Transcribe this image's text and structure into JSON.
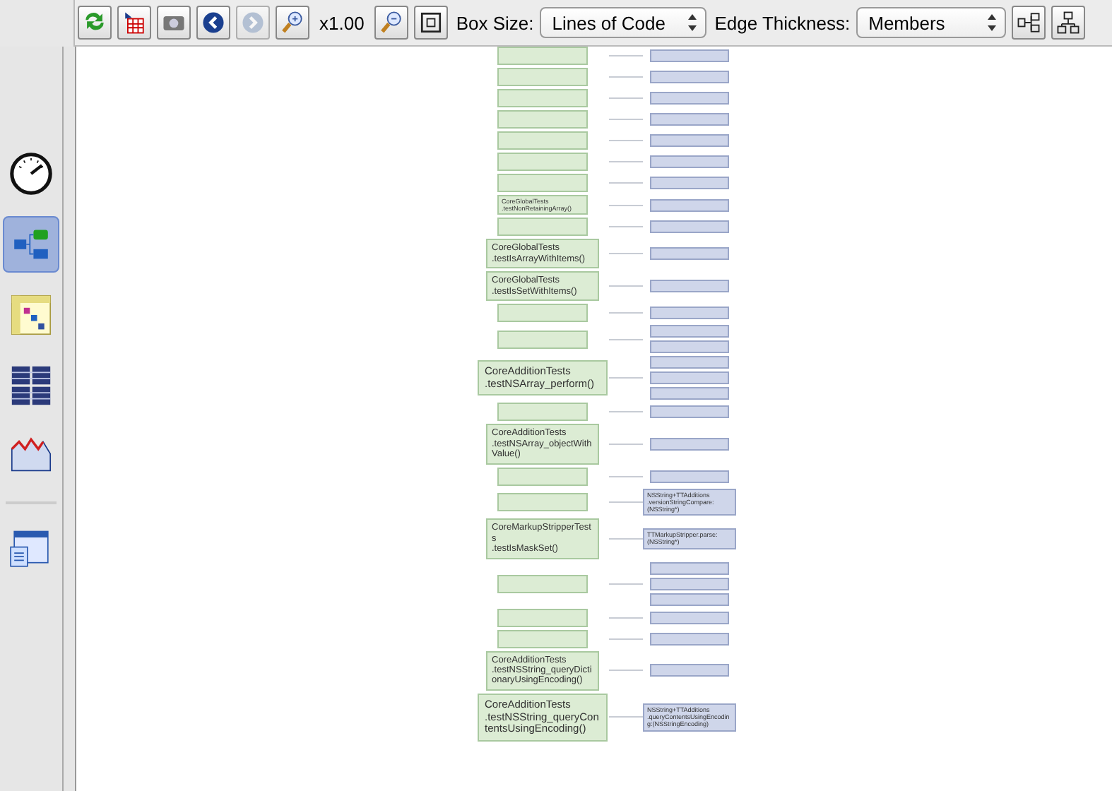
{
  "toolbar": {
    "buttons": [
      {
        "kind": "refresh",
        "disabled": false
      },
      {
        "kind": "export",
        "disabled": false
      },
      {
        "kind": "camera",
        "disabled": false
      },
      {
        "kind": "back",
        "disabled": false
      },
      {
        "kind": "forward",
        "disabled": true
      },
      {
        "kind": "zoom-in",
        "disabled": false
      }
    ],
    "zoom": "x1.00",
    "buttons_after": [
      {
        "kind": "zoom-out",
        "disabled": false
      },
      {
        "kind": "fit",
        "disabled": false
      }
    ],
    "box_size": {
      "label": "Box Size:",
      "value": "Lines of Code"
    },
    "edge_thickness": {
      "label": "Edge Thickness:",
      "value": "Members"
    },
    "layout_buttons": [
      {
        "kind": "horizontal",
        "disabled": false
      },
      {
        "kind": "vertical",
        "disabled": false
      }
    ]
  },
  "sidebar": {
    "items": [
      {
        "kind": "gauge",
        "selected": false
      },
      {
        "kind": "graph",
        "selected": true
      },
      {
        "kind": "matrix",
        "selected": false
      },
      {
        "kind": "grid",
        "selected": false
      },
      {
        "kind": "chart",
        "selected": false
      },
      {
        "kind": "window",
        "selected": false
      }
    ]
  },
  "graph": {
    "rows": [
      {
        "source": {
          "kind": "small"
        },
        "targets": [
          {
            "kind": "small"
          }
        ]
      },
      {
        "source": {
          "kind": "small"
        },
        "targets": [
          {
            "kind": "small"
          }
        ]
      },
      {
        "source": {
          "kind": "small"
        },
        "targets": [
          {
            "kind": "small"
          }
        ]
      },
      {
        "source": {
          "kind": "small"
        },
        "targets": [
          {
            "kind": "small"
          }
        ]
      },
      {
        "source": {
          "kind": "small"
        },
        "targets": [
          {
            "kind": "small"
          }
        ]
      },
      {
        "source": {
          "kind": "small"
        },
        "targets": [
          {
            "kind": "small"
          }
        ]
      },
      {
        "source": {
          "kind": "small"
        },
        "targets": [
          {
            "kind": "small"
          }
        ]
      },
      {
        "source": {
          "kind": "small",
          "lines": [
            "CoreGlobalTests",
            ".testNonRetainingArray()"
          ]
        },
        "targets": [
          {
            "kind": "small"
          }
        ]
      },
      {
        "source": {
          "kind": "small"
        },
        "targets": [
          {
            "kind": "small"
          }
        ]
      },
      {
        "source": {
          "kind": "medium",
          "lines": [
            "CoreGlobalTests",
            ".testIsArrayWithItems()"
          ]
        },
        "targets": [
          {
            "kind": "small"
          }
        ]
      },
      {
        "source": {
          "kind": "medium",
          "lines": [
            "CoreGlobalTests",
            ".testIsSetWithItems()"
          ]
        },
        "targets": [
          {
            "kind": "small"
          }
        ]
      },
      {
        "source": {
          "kind": "small"
        },
        "targets": [
          {
            "kind": "small"
          }
        ]
      },
      {
        "source": {
          "kind": "small"
        },
        "targets": [
          {
            "kind": "small"
          },
          {
            "kind": "small"
          }
        ]
      },
      {
        "source": {
          "kind": "large",
          "lines": [
            "CoreAdditionTests",
            ".testNSArray_perform()"
          ]
        },
        "targets": [
          {
            "kind": "small"
          },
          {
            "kind": "small"
          },
          {
            "kind": "small"
          }
        ]
      },
      {
        "source": {
          "kind": "small"
        },
        "targets": [
          {
            "kind": "small"
          }
        ]
      },
      {
        "source": {
          "kind": "medium",
          "lines": [
            "CoreAdditionTests",
            ".testNSArray_objectWithValue()"
          ]
        },
        "targets": [
          {
            "kind": "small"
          }
        ]
      },
      {
        "source": {
          "kind": "small"
        },
        "targets": [
          {
            "kind": "small"
          }
        ]
      },
      {
        "source": {
          "kind": "small"
        },
        "targets": [
          {
            "kind": "small",
            "lines": [
              "NSString+TTAdditions",
              ".versionStringCompare:(NSString*)"
            ]
          }
        ]
      },
      {
        "source": {
          "kind": "medium",
          "lines": [
            "CoreMarkupStripperTests",
            ".testIsMaskSet()"
          ]
        },
        "targets": [
          {
            "kind": "small",
            "lines": [
              "TTMarkupStripper.parse:(NSString*)"
            ]
          }
        ]
      },
      {
        "source": {
          "kind": "small"
        },
        "targets": [
          {
            "kind": "small"
          },
          {
            "kind": "small"
          },
          {
            "kind": "small"
          }
        ]
      },
      {
        "source": {
          "kind": "small"
        },
        "targets": [
          {
            "kind": "small"
          }
        ]
      },
      {
        "source": {
          "kind": "small"
        },
        "targets": [
          {
            "kind": "small"
          }
        ]
      },
      {
        "source": {
          "kind": "medium",
          "lines": [
            "CoreAdditionTests",
            ".testNSString_queryDictionaryUsingEncoding()"
          ]
        },
        "targets": [
          {
            "kind": "small"
          }
        ]
      },
      {
        "source": {
          "kind": "large",
          "lines": [
            "CoreAdditionTests",
            ".testNSString_queryContentsUsingEncoding()"
          ]
        },
        "targets": [
          {
            "kind": "small",
            "lines": [
              "NSString+TTAdditions",
              ".queryContentsUsingEncoding:(NSStringEncoding)"
            ]
          }
        ]
      }
    ]
  }
}
